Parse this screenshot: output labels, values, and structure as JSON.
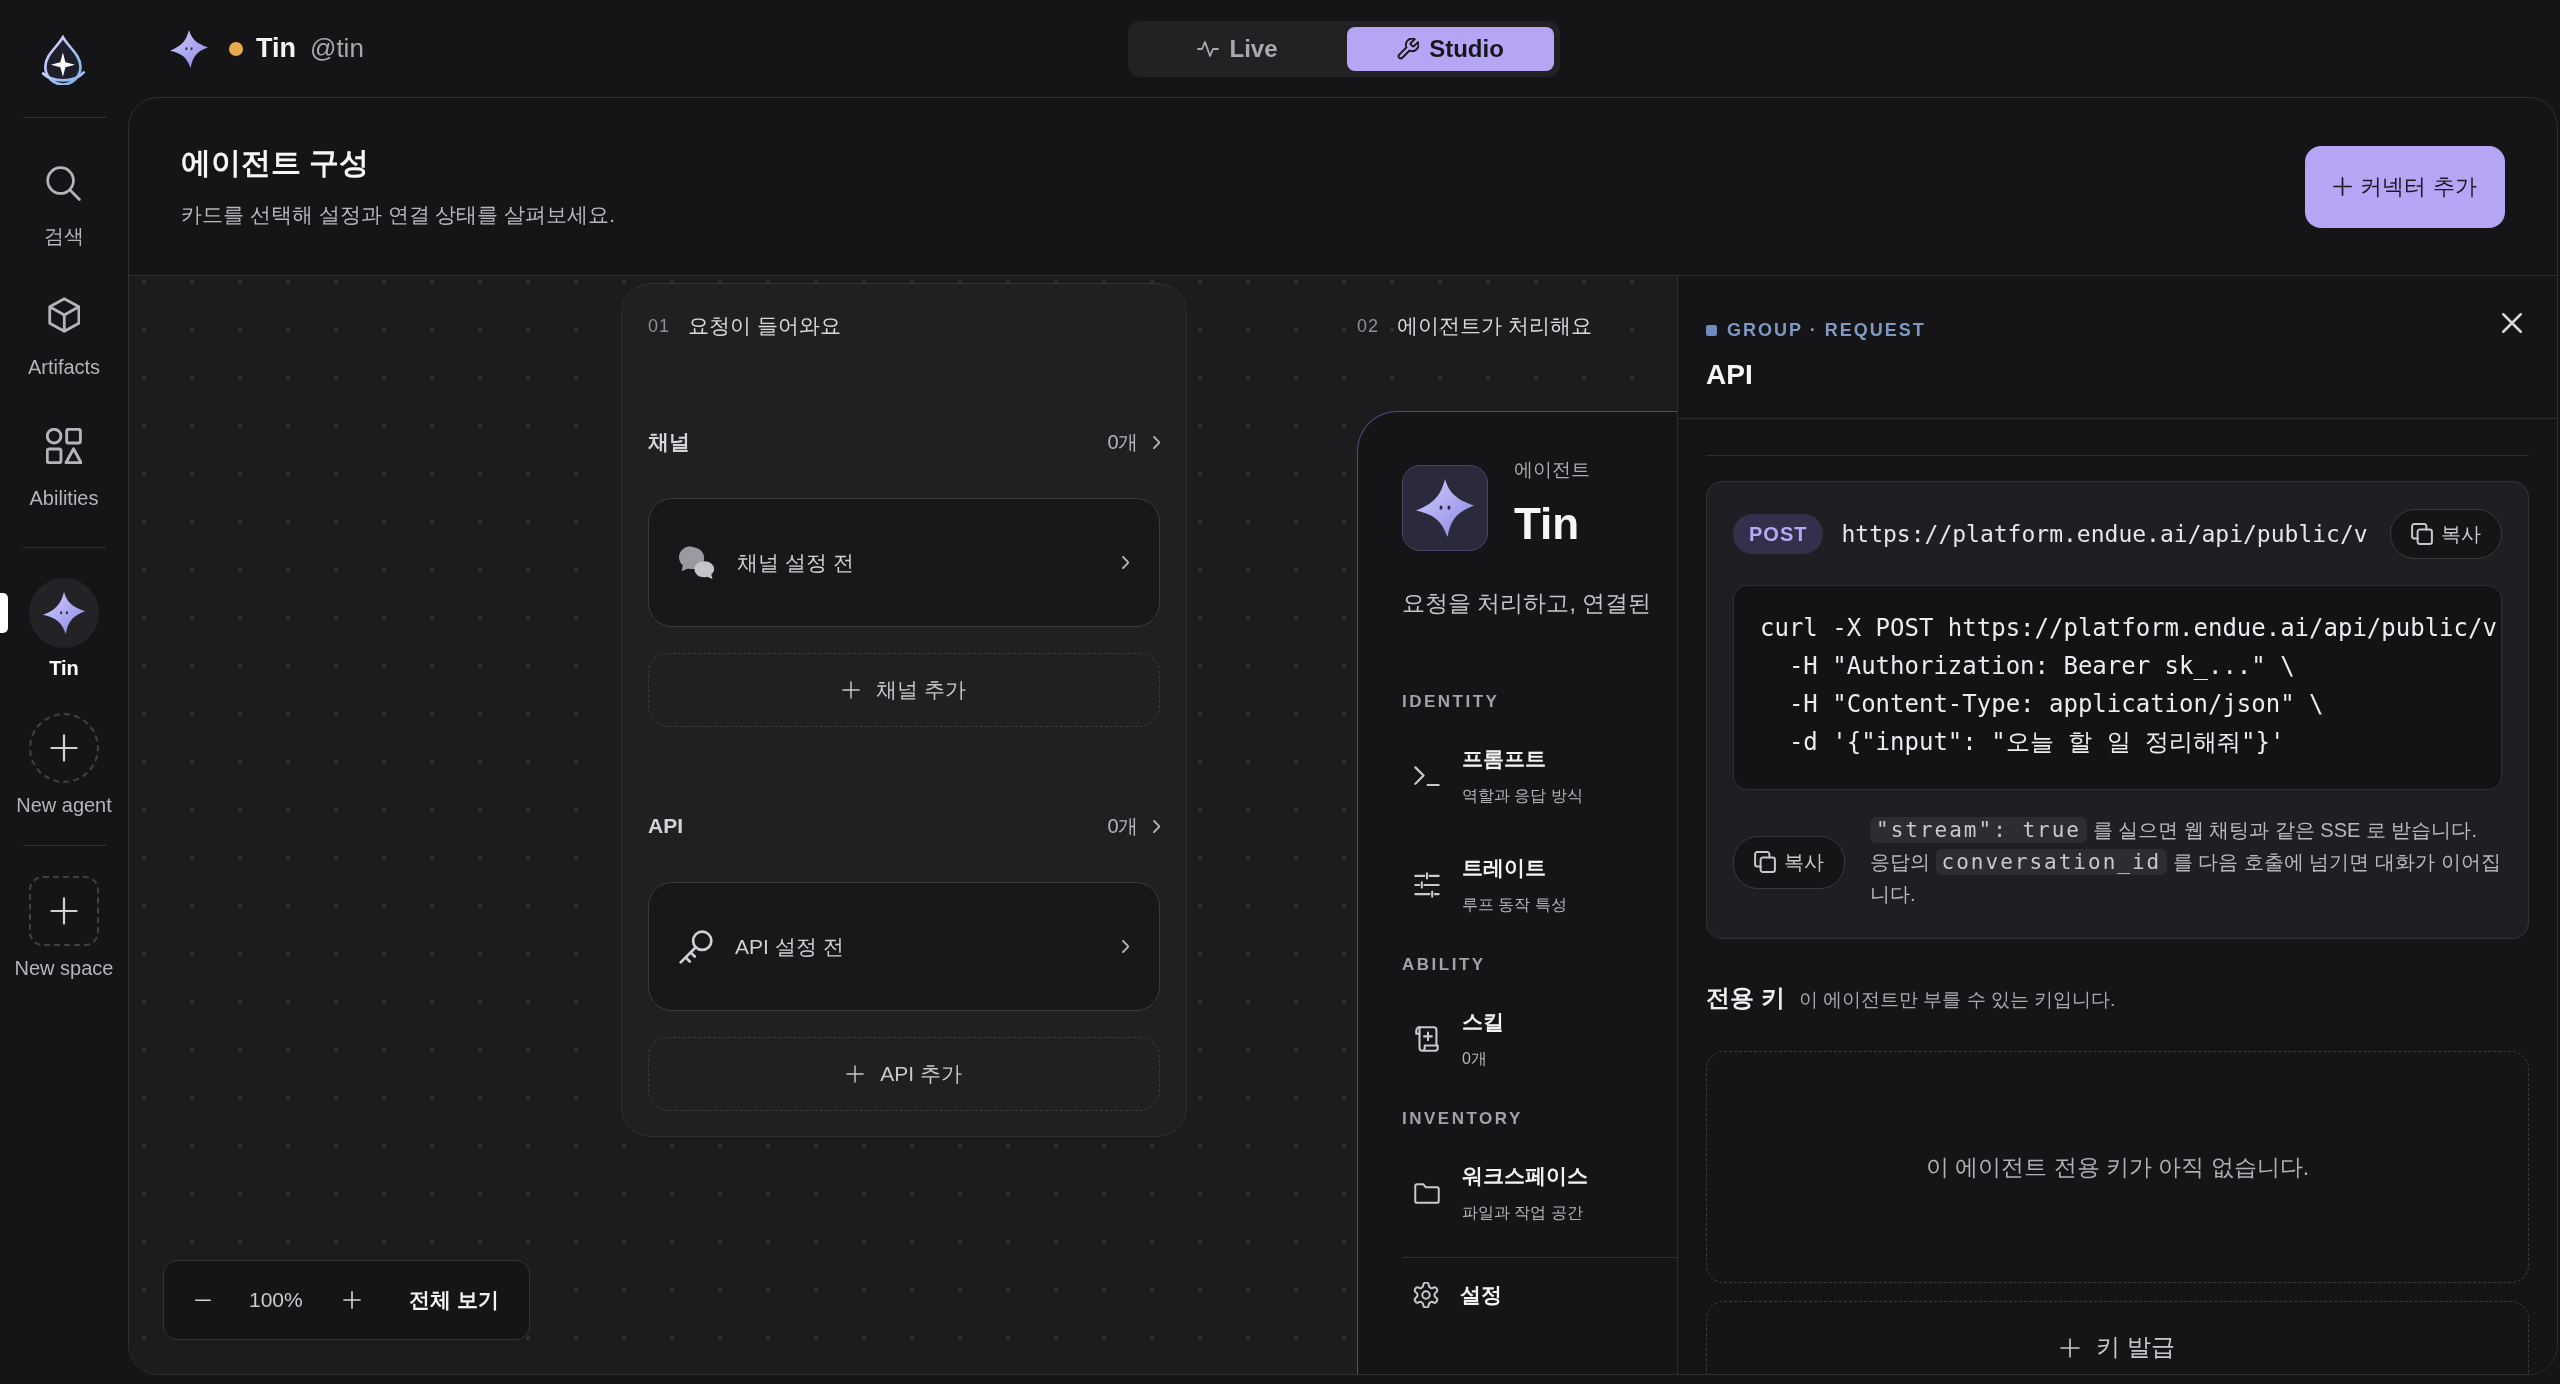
{
  "sidebar": {
    "nav": [
      {
        "label": "검색",
        "selected": false
      },
      {
        "label": "Artifacts",
        "selected": false
      },
      {
        "label": "Abilities",
        "selected": false
      }
    ],
    "agents": {
      "items": [
        {
          "label": "Tin",
          "selected": true
        }
      ],
      "create": "New agent"
    },
    "spaces": {
      "create": "New space"
    }
  },
  "agent": {
    "name": "Tin",
    "handle": "@tin"
  },
  "modes": [
    {
      "label": "Live",
      "selected": false
    },
    {
      "label": "Studio",
      "selected": true
    }
  ],
  "header": {
    "title": "에이전트 구성",
    "subtitle": "카드를 선택해 설정과 연결 상태를 살펴보세요.",
    "action": "커넥터 추가"
  },
  "canvas": {
    "request_step": {
      "number": "01",
      "title": "요청이 들어와요",
      "groups": [
        {
          "title": "채널",
          "count": "0개",
          "placeholder": "채널 설정 전",
          "add": "채널 추가"
        },
        {
          "title": "API",
          "count": "0개",
          "placeholder": "API 설정 전",
          "add": "API 추가"
        }
      ]
    },
    "agent_step": {
      "number": "02",
      "title": "에이전트가 처리해요",
      "caption": "에이전트",
      "name": "Tin",
      "description": "요청을 처리하고, 연결된",
      "sections": [
        {
          "title": "IDENTITY",
          "items": [
            {
              "title": "프롬프트",
              "subtitle": "역할과 응답 방식"
            },
            {
              "title": "트레이트",
              "subtitle": "루프 동작 특성"
            }
          ]
        },
        {
          "title": "ABILITY",
          "items": [
            {
              "title": "스킬",
              "subtitle": "0개"
            }
          ]
        },
        {
          "title": "INVENTORY",
          "items": [
            {
              "title": "워크스페이스",
              "subtitle": "파일과 작업 공간"
            }
          ]
        }
      ],
      "settings": "설정"
    },
    "zoom": {
      "percent": "100%",
      "fit": "전체 보기"
    }
  },
  "detail": {
    "breadcrumb": "GROUP · REQUEST",
    "title": "API",
    "endpoint": {
      "method": "POST",
      "url": "https://platform.endue.ai/api/public/v",
      "copy": "복사",
      "code": [
        "curl -X POST https://platform.endue.ai/api/public/v",
        "  -H \"Authorization: Bearer sk_...\" \\",
        "  -H \"Content-Type: application/json\" \\",
        "  -d '{\"input\": \"오늘 할 일 정리해줘\"}'"
      ],
      "note_copy": "복사",
      "note": [
        {
          "kind": "code",
          "text": "\"stream\": true"
        },
        {
          "kind": "text",
          "text": " 를 실으면 웹 채팅과 같은 SSE 로 받습니다. 응답의 "
        },
        {
          "kind": "code",
          "text": "conversation_id"
        },
        {
          "kind": "text",
          "text": " 를 다음 호출에 넘기면 대화가 이어집니다."
        }
      ]
    },
    "keys": {
      "title": "전용 키",
      "hint": "이 에이전트만 부를 수 있는 키입니다.",
      "empty": "이 에이전트 전용 키가 아직 없습니다.",
      "action": "키 발급"
    }
  }
}
